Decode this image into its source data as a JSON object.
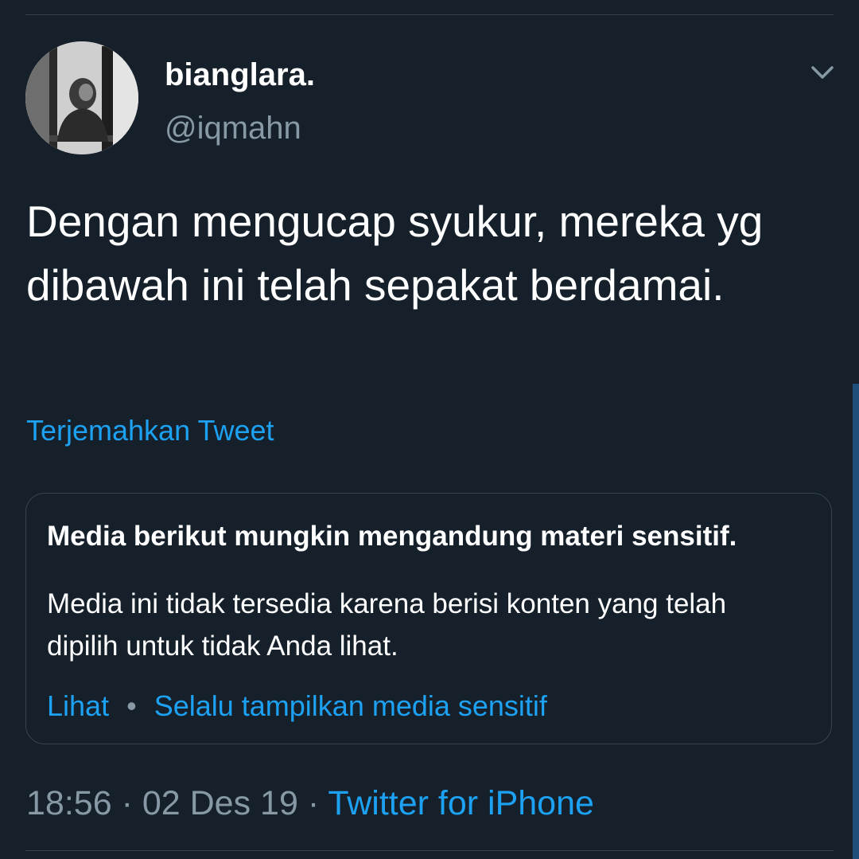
{
  "colors": {
    "background": "#15202b",
    "primary_text": "#ffffff",
    "secondary_text": "#8899a6",
    "accent": "#1da1f2",
    "border": "#38444d"
  },
  "author": {
    "display_name": "bianglara.",
    "handle": "@iqmahn",
    "avatar_icon": "avatar-photo"
  },
  "header": {
    "menu_icon": "chevron-down-icon"
  },
  "tweet": {
    "text": "Dengan mengucap syukur, mereka yg dibawah ini telah sepakat berdamai.",
    "translate_label": "Terjemahkan Tweet"
  },
  "sensitive_media": {
    "title": "Media berikut mungkin mengandung materi sensitif.",
    "body": "Media ini tidak tersedia karena berisi konten yang telah dipilih untuk tidak Anda lihat.",
    "view_label": "Lihat",
    "separator": "•",
    "always_show_label": "Selalu tampilkan media sensitif"
  },
  "meta": {
    "time": "18:56",
    "separator": "·",
    "date": "02 Des 19",
    "source": "Twitter for iPhone"
  }
}
